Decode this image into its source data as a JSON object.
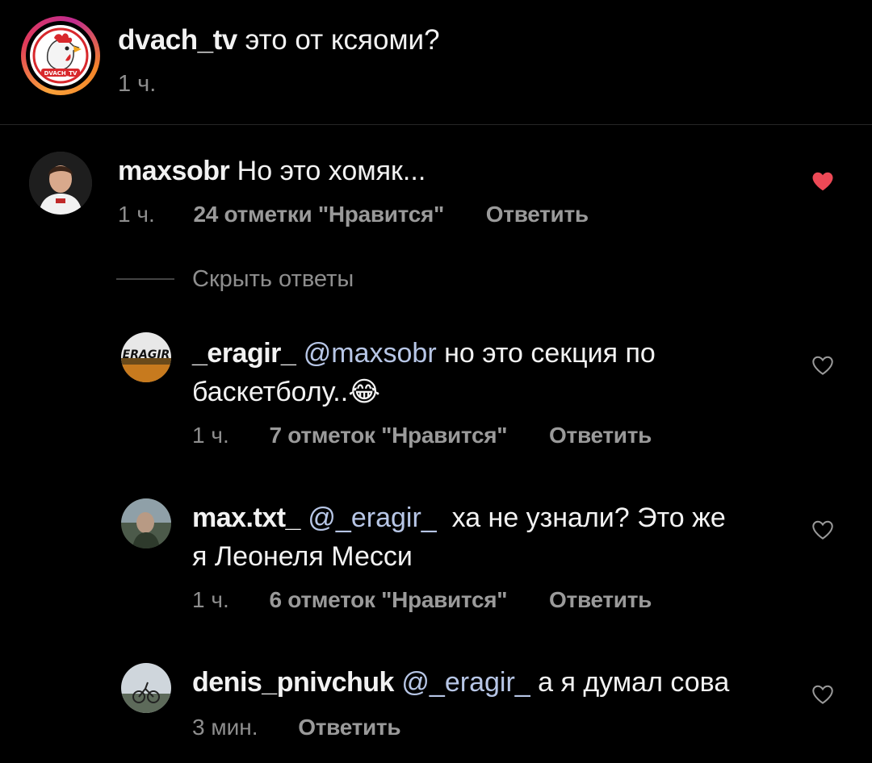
{
  "caption": {
    "username": "dvach_tv",
    "text": " это от ксяоми?",
    "time": "1 ч.",
    "avatar_logo_text": "DVACH_TV",
    "avatar_icon": "rooster-logo-icon"
  },
  "comments": [
    {
      "username": "maxsobr",
      "text": " Но это хомяк...",
      "time": "1 ч.",
      "likes": "24 отметки \"Нравится\"",
      "reply": "Ответить",
      "liked": true,
      "avatar_icon": "profile-photo-icon"
    }
  ],
  "hide_replies": "Скрыть ответы",
  "replies": [
    {
      "username": "_eragir_",
      "mention": "@maxsobr",
      "text_line1": " но это секция по",
      "text_line2": "баскетболу..",
      "emoji": "😂",
      "time": "1 ч.",
      "likes": "7 отметок \"Нравится\"",
      "reply": "Ответить",
      "avatar_text": "ERAGIR"
    },
    {
      "username": "max.txt_",
      "mention": "@_eragir_",
      "text_line1": "  ха не узнали? Это же",
      "text_line2": "я Леонеля Месси",
      "time": "1 ч.",
      "likes": "6 отметок \"Нравится\"",
      "reply": "Ответить"
    },
    {
      "username": "denis_pnivchuk",
      "mention": "@_eragir_",
      "text_line1": " а я думал сова",
      "time": "3 мин.",
      "reply": "Ответить"
    }
  ],
  "colors": {
    "background": "#000000",
    "text": "#f2f2f2",
    "secondary": "#8e8e8e",
    "mention": "#b7c6e6",
    "like_red": "#ed4956"
  }
}
